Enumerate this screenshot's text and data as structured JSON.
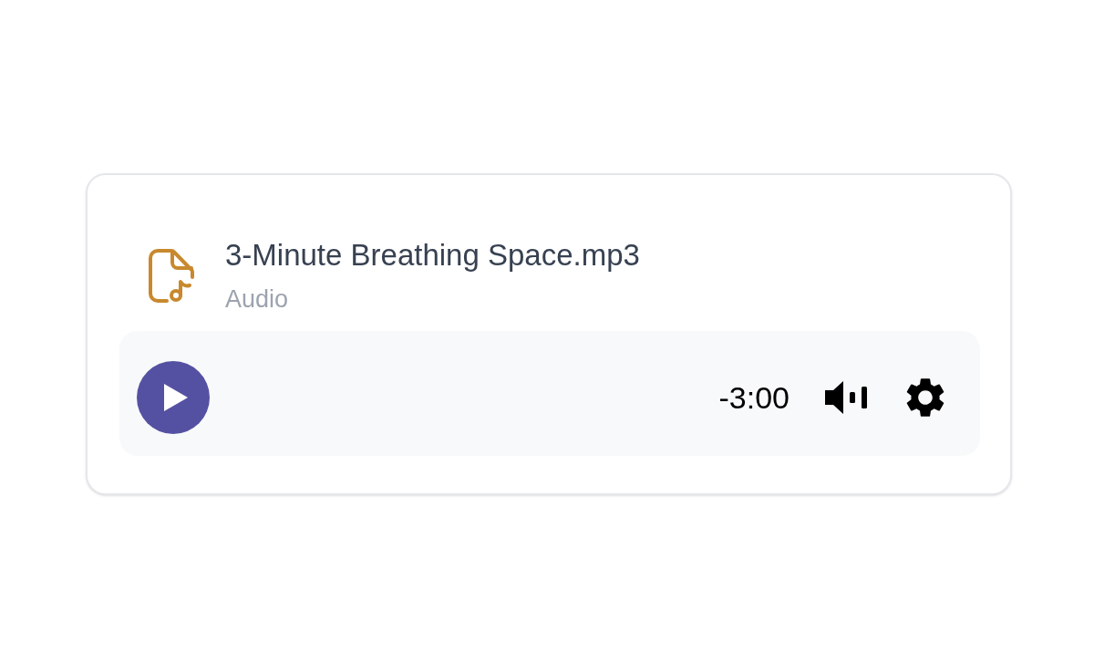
{
  "file": {
    "name": "3-Minute Breathing Space.mp3",
    "type": "Audio"
  },
  "player": {
    "playing": false,
    "time_remaining": "-3:00"
  }
}
